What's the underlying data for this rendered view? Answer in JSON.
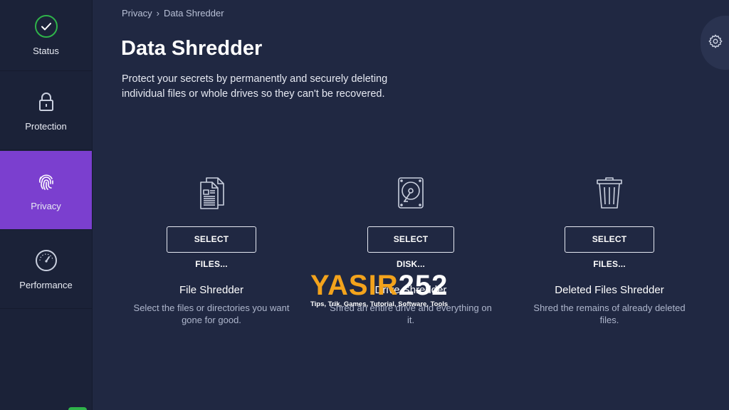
{
  "sidebar": {
    "items": [
      {
        "label": "Status",
        "icon": "check-circle-icon",
        "active": false
      },
      {
        "label": "Protection",
        "icon": "lock-icon",
        "active": false
      },
      {
        "label": "Privacy",
        "icon": "fingerprint-icon",
        "active": true
      },
      {
        "label": "Performance",
        "icon": "gauge-icon",
        "active": false
      }
    ]
  },
  "breadcrumb": {
    "parent": "Privacy",
    "separator": "›",
    "current": "Data Shredder"
  },
  "page": {
    "title": "Data Shredder",
    "description": "Protect your secrets by permanently and securely deleting individual files or whole drives so they can't be recovered."
  },
  "settings": {
    "icon": "gear-icon"
  },
  "cards": [
    {
      "icon": "documents-icon",
      "button": "SELECT FILES...",
      "title": "File Shredder",
      "description": "Select the files or directories you want gone for good."
    },
    {
      "icon": "hard-disk-icon",
      "button": "SELECT DISK...",
      "title": "Drive Shredder",
      "description": "Shred an entire drive and everything on it."
    },
    {
      "icon": "trash-icon",
      "button": "SELECT FILES...",
      "title": "Deleted Files Shredder",
      "description": "Shred the remains of already deleted files."
    }
  ],
  "watermark": {
    "part1": "YASIR",
    "part2": "252",
    "tagline": "Tips, Trik, Games, Tutorial, Software, Tools"
  },
  "colors": {
    "background": "#202842",
    "sidebar": "#1b2238",
    "active": "#7b3fcf",
    "status_ok": "#2fb34a",
    "watermark_accent": "#f3a31c"
  }
}
